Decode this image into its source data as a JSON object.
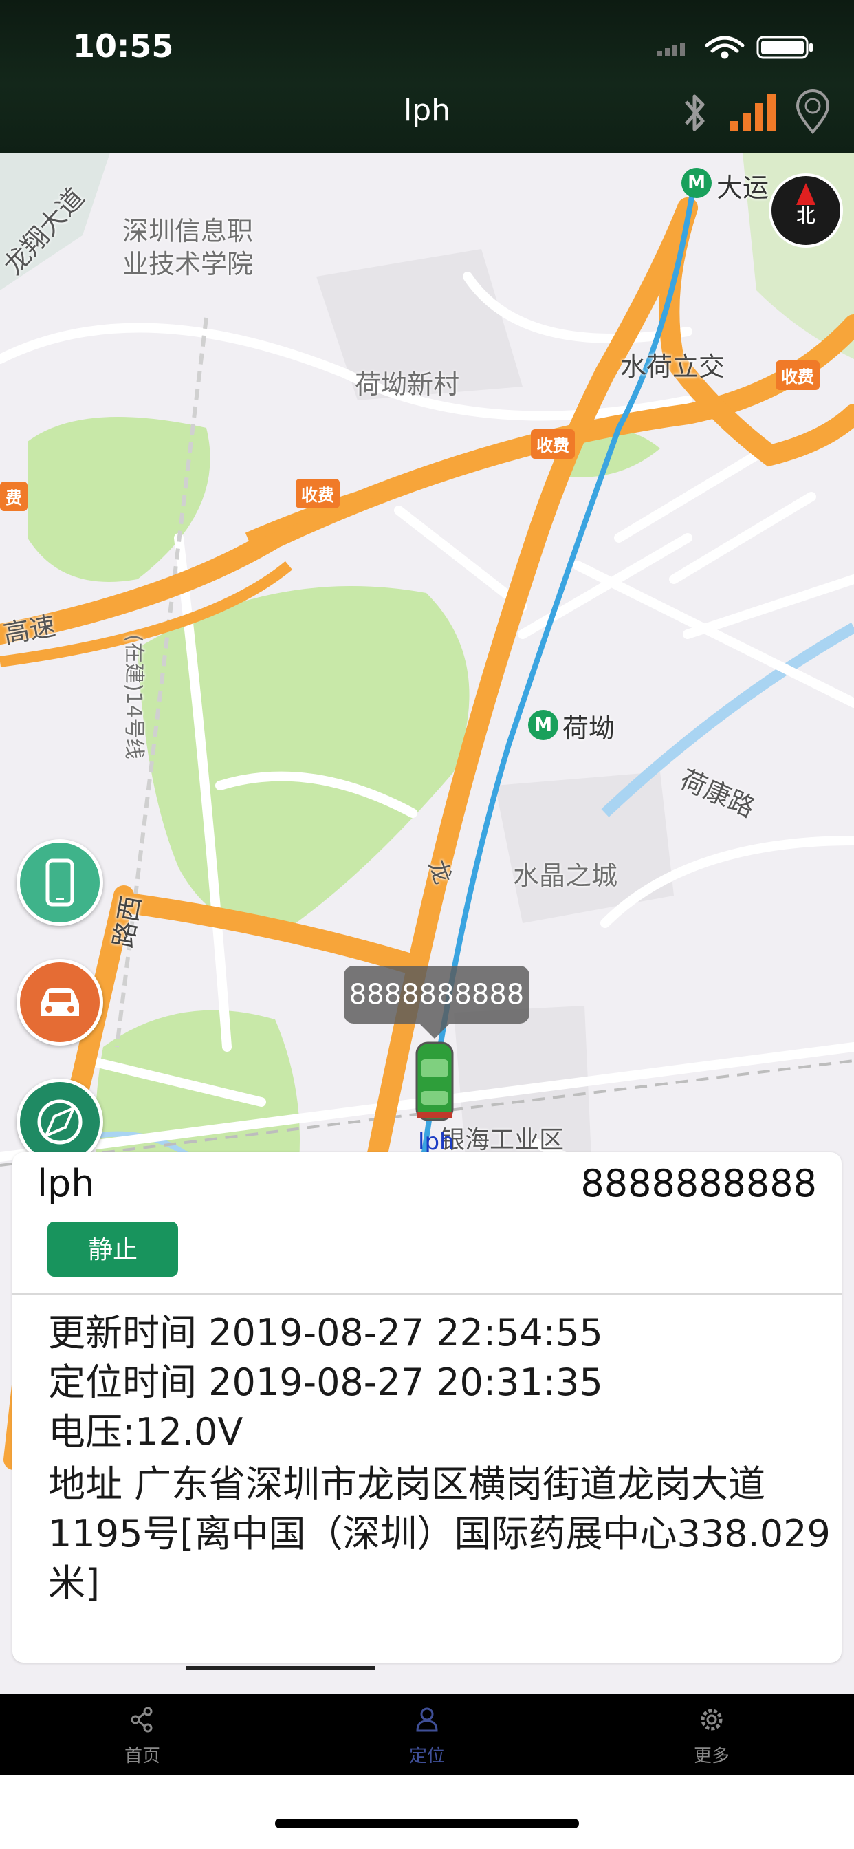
{
  "status_bar": {
    "time": "10:55"
  },
  "nav": {
    "title": "lph",
    "icons": [
      "bluetooth-icon",
      "signal-bars-icon",
      "gps-pin-icon"
    ]
  },
  "map": {
    "labels": {
      "school": "深圳信息职\n业技术学院",
      "avenue_nw": "龙翔大道",
      "heao_xincun": "荷坳新村",
      "shuihe_interchange": "水荷立交",
      "dayun": "大运",
      "heao": "荷坳",
      "hekang_road": "荷康路",
      "crystal_city": "水晶之城",
      "yinhai": "银海工业区",
      "highway_left": "高速",
      "toll_1": "收费",
      "toll_2": "收费",
      "toll_3": "收费",
      "toll_4": "费",
      "road_vertical": "(在建)14号线",
      "road_west": "路西",
      "longgang_sign": "龙",
      "metro_glyph": "M",
      "compass": "北"
    },
    "vehicle": {
      "bubble_number": "8888888888",
      "label": "lph"
    },
    "colors": {
      "highway": "#f7a53a",
      "metro_line": "#3aa4e0",
      "park": "#c8e8a8",
      "water": "#a9d4f2"
    }
  },
  "side_buttons": [
    "phone-button",
    "car-button",
    "navigation-button"
  ],
  "panel": {
    "name": "lph",
    "number": "8888888888",
    "status": "静止",
    "update_time": "更新时间 2019-08-27 22:54:55",
    "locate_time": "定位时间 2019-08-27 20:31:35",
    "voltage": "电压:12.0V",
    "address": "地址 广东省深圳市龙岗区横岗街道龙岗大道1195号[离中国（深圳）国际药展中心338.029米]"
  },
  "tabbar": {
    "tabs": [
      {
        "label": "首页",
        "icon": "share-icon",
        "active": false
      },
      {
        "label": "定位",
        "icon": "person-pin-icon",
        "active": true
      },
      {
        "label": "更多",
        "icon": "gear-icon",
        "active": false
      }
    ]
  }
}
